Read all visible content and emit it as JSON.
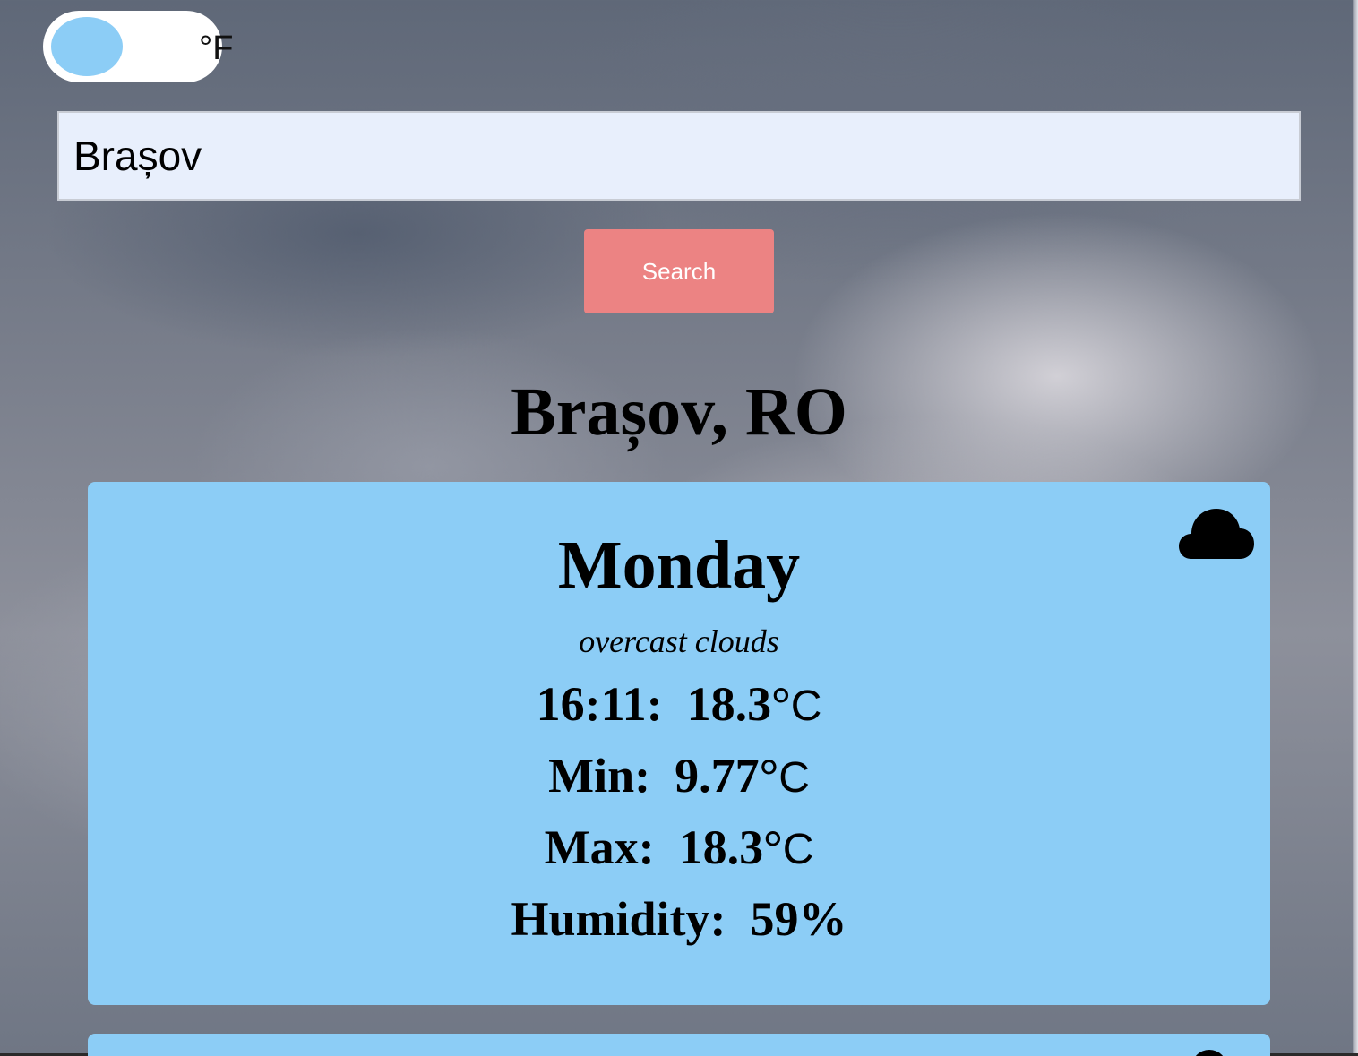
{
  "unit_toggle": {
    "label": "°F"
  },
  "search": {
    "value": "Brașov",
    "button_label": "Search"
  },
  "location": {
    "title": "Brașov, RO"
  },
  "forecast": [
    {
      "day": "Monday",
      "description": "overcast clouds",
      "icon": "cloud-icon",
      "time_label": "16:11:",
      "time_temp": "18.3°",
      "min_label": "Min:",
      "min_temp": "9.77°",
      "max_label": "Max:",
      "max_temp": "18.3°",
      "humidity_label": "Humidity:",
      "humidity_value": "59%",
      "unit": "C"
    }
  ],
  "colors": {
    "card": "#8ccdf6",
    "button": "#ec8383",
    "input": "#e8effc"
  }
}
